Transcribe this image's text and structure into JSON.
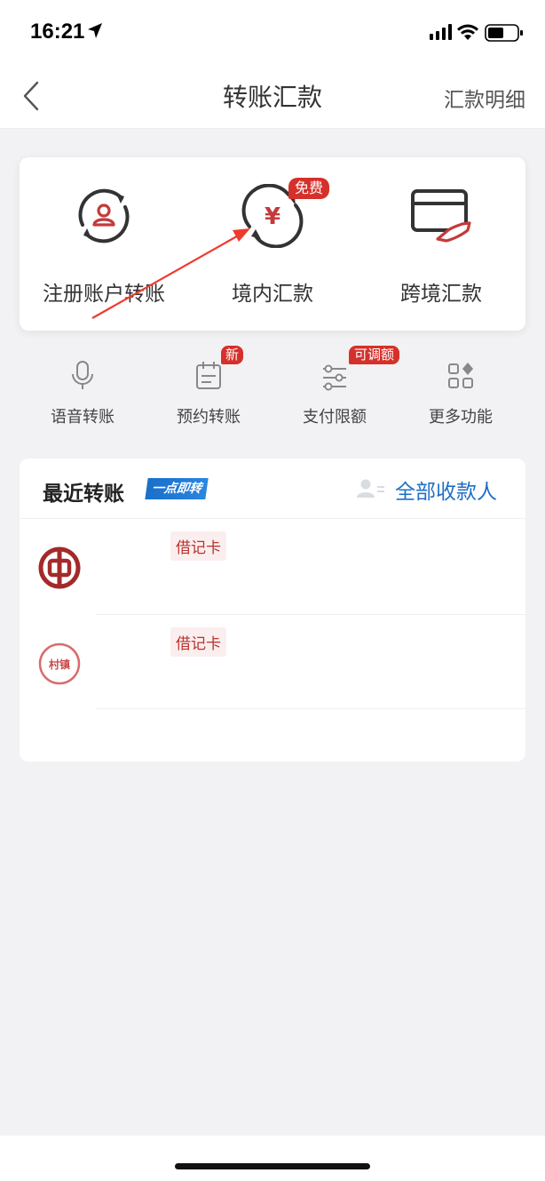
{
  "status_bar": {
    "time": "16:21"
  },
  "nav": {
    "title": "转账汇款",
    "right_label": "汇款明细"
  },
  "main_actions": [
    {
      "label": "注册账户转账",
      "icon": "user-cycle-icon"
    },
    {
      "label": "境内汇款",
      "icon": "yuan-cycle-icon",
      "badge": "免费"
    },
    {
      "label": "跨境汇款",
      "icon": "card-hand-icon"
    }
  ],
  "secondary_actions": [
    {
      "label": "语音转账",
      "icon": "microphone-icon"
    },
    {
      "label": "预约转账",
      "icon": "calendar-icon",
      "badge": "新"
    },
    {
      "label": "支付限额",
      "icon": "sliders-icon",
      "badge": "可调额"
    },
    {
      "label": "更多功能",
      "icon": "grid-icon"
    }
  ],
  "recent": {
    "title": "最近转账",
    "tag": "一点即转",
    "all_payees": "全部收款人",
    "items": [
      {
        "bank_icon": "bank-of-china-logo",
        "card_type": "借记卡"
      },
      {
        "bank_icon": "village-bank-logo",
        "bank_text": "村镇",
        "card_type": "借记卡"
      }
    ]
  },
  "colors": {
    "accent_red": "#d6302b",
    "link_blue": "#1f6fc6",
    "bank_red": "#a32a2a"
  }
}
